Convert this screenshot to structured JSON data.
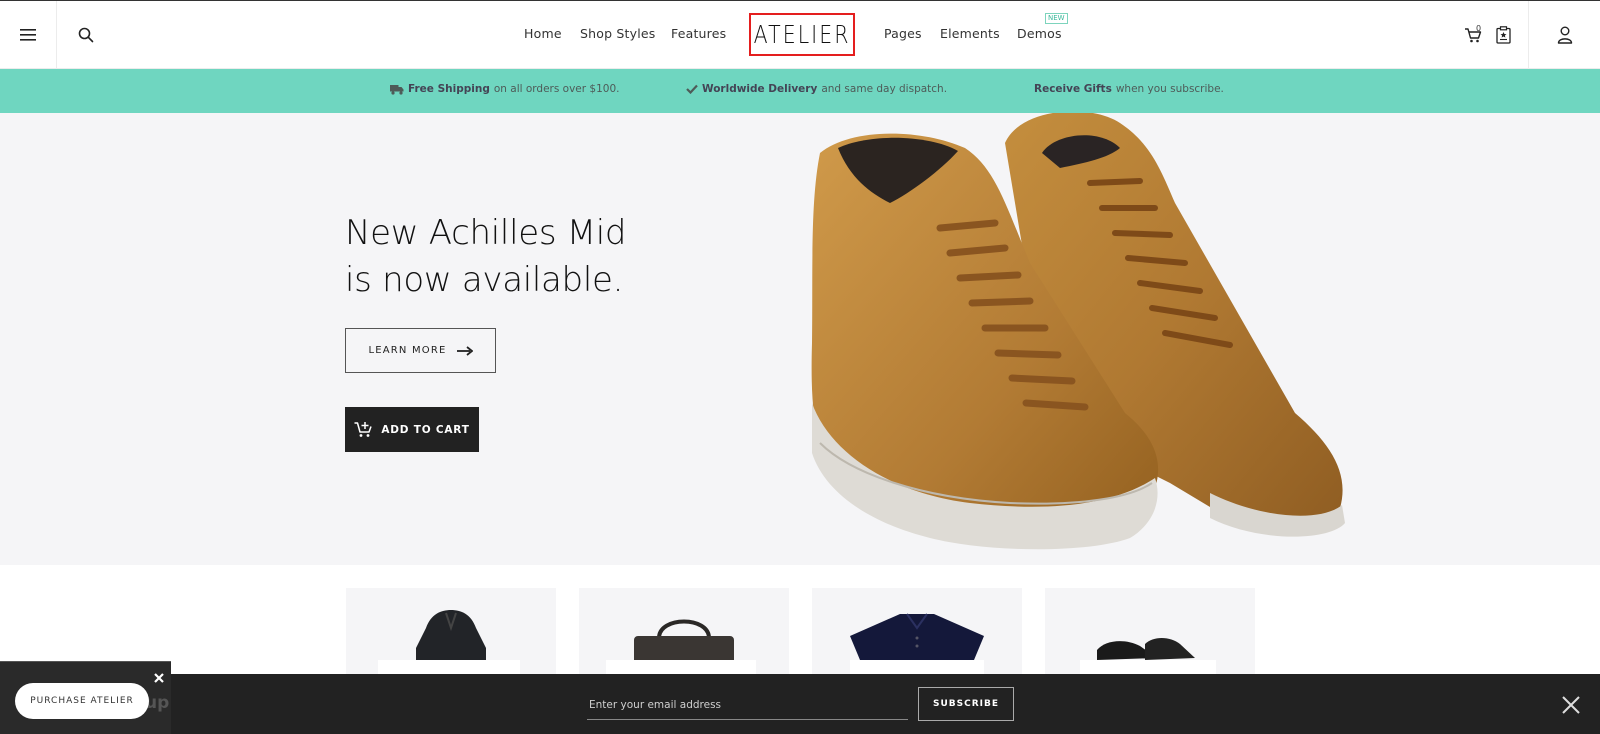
{
  "header": {
    "logo_text": "ATELIER",
    "nav_left": [
      "Home",
      "Shop Styles",
      "Features"
    ],
    "nav_right": [
      "Pages",
      "Elements",
      "Demos"
    ],
    "new_badge": "NEW",
    "cart_count": "0",
    "icons": {
      "menu": "hamburger-menu-icon",
      "search": "search-icon",
      "cart": "cart-icon",
      "wishlist": "wishlist-icon",
      "account": "user-icon"
    },
    "logo_border_color": "#e41e1e"
  },
  "promo": {
    "background": "#6fd6c0",
    "items": [
      {
        "icon": "truck-icon",
        "strong": "Free Shipping",
        "text": "on all orders over $100."
      },
      {
        "icon": "check-icon",
        "strong": "Worldwide Delivery",
        "text": "and same day dispatch."
      },
      {
        "icon": "",
        "strong": "Receive Gifts",
        "text": "when you subscribe."
      }
    ]
  },
  "hero": {
    "title_line1": "New Achilles Mid",
    "title_line2": "is now available.",
    "learn_more": "LEARN MORE",
    "add_to_cart": "ADD TO CART"
  },
  "newsletter": {
    "email_placeholder": "Enter your email address",
    "subscribe_label": "SUBSCRIBE"
  },
  "purchase_widget": {
    "button_label": "PURCHASE ATELIER",
    "ghost_text": "up"
  }
}
